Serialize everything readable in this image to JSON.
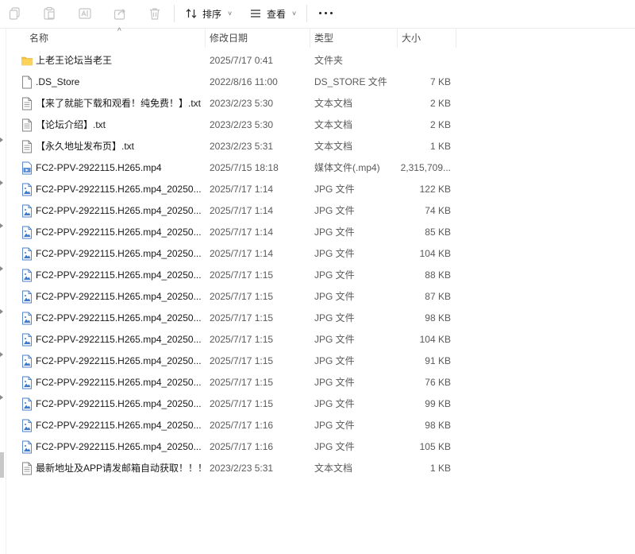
{
  "toolbar": {
    "sort_label": "排序",
    "view_label": "查看"
  },
  "columns": {
    "name": "名称",
    "modified": "修改日期",
    "type": "类型",
    "size": "大小"
  },
  "files": [
    {
      "icon": "folder-icon",
      "name": "上老王论坛当老王",
      "date": "2025/7/17 0:41",
      "type": "文件夹",
      "size": ""
    },
    {
      "icon": "file-icon",
      "name": ".DS_Store",
      "date": "2022/8/16 11:00",
      "type": "DS_STORE 文件",
      "size": "7 KB"
    },
    {
      "icon": "text-file-icon",
      "name": "【来了就能下载和观看！纯免费！】.txt",
      "date": "2023/2/23 5:30",
      "type": "文本文档",
      "size": "2 KB"
    },
    {
      "icon": "text-file-icon",
      "name": "【论坛介绍】.txt",
      "date": "2023/2/23 5:30",
      "type": "文本文档",
      "size": "2 KB"
    },
    {
      "icon": "text-file-icon",
      "name": "【永久地址发布页】.txt",
      "date": "2023/2/23 5:31",
      "type": "文本文档",
      "size": "1 KB"
    },
    {
      "icon": "video-file-icon",
      "name": "FC2-PPV-2922115.H265.mp4",
      "date": "2025/7/15 18:18",
      "type": "媒体文件(.mp4)",
      "size": "2,315,709..."
    },
    {
      "icon": "image-file-icon",
      "name": "FC2-PPV-2922115.H265.mp4_20250...",
      "date": "2025/7/17 1:14",
      "type": "JPG 文件",
      "size": "122 KB"
    },
    {
      "icon": "image-file-icon",
      "name": "FC2-PPV-2922115.H265.mp4_20250...",
      "date": "2025/7/17 1:14",
      "type": "JPG 文件",
      "size": "74 KB"
    },
    {
      "icon": "image-file-icon",
      "name": "FC2-PPV-2922115.H265.mp4_20250...",
      "date": "2025/7/17 1:14",
      "type": "JPG 文件",
      "size": "85 KB"
    },
    {
      "icon": "image-file-icon",
      "name": "FC2-PPV-2922115.H265.mp4_20250...",
      "date": "2025/7/17 1:14",
      "type": "JPG 文件",
      "size": "104 KB"
    },
    {
      "icon": "image-file-icon",
      "name": "FC2-PPV-2922115.H265.mp4_20250...",
      "date": "2025/7/17 1:15",
      "type": "JPG 文件",
      "size": "88 KB"
    },
    {
      "icon": "image-file-icon",
      "name": "FC2-PPV-2922115.H265.mp4_20250...",
      "date": "2025/7/17 1:15",
      "type": "JPG 文件",
      "size": "87 KB"
    },
    {
      "icon": "image-file-icon",
      "name": "FC2-PPV-2922115.H265.mp4_20250...",
      "date": "2025/7/17 1:15",
      "type": "JPG 文件",
      "size": "98 KB"
    },
    {
      "icon": "image-file-icon",
      "name": "FC2-PPV-2922115.H265.mp4_20250...",
      "date": "2025/7/17 1:15",
      "type": "JPG 文件",
      "size": "104 KB"
    },
    {
      "icon": "image-file-icon",
      "name": "FC2-PPV-2922115.H265.mp4_20250...",
      "date": "2025/7/17 1:15",
      "type": "JPG 文件",
      "size": "91 KB"
    },
    {
      "icon": "image-file-icon",
      "name": "FC2-PPV-2922115.H265.mp4_20250...",
      "date": "2025/7/17 1:15",
      "type": "JPG 文件",
      "size": "76 KB"
    },
    {
      "icon": "image-file-icon",
      "name": "FC2-PPV-2922115.H265.mp4_20250...",
      "date": "2025/7/17 1:15",
      "type": "JPG 文件",
      "size": "99 KB"
    },
    {
      "icon": "image-file-icon",
      "name": "FC2-PPV-2922115.H265.mp4_20250...",
      "date": "2025/7/17 1:16",
      "type": "JPG 文件",
      "size": "98 KB"
    },
    {
      "icon": "image-file-icon",
      "name": "FC2-PPV-2922115.H265.mp4_20250...",
      "date": "2025/7/17 1:16",
      "type": "JPG 文件",
      "size": "105 KB"
    },
    {
      "icon": "text-file-icon",
      "name": "最新地址及APP请发邮箱自动获取！！！...",
      "date": "2023/2/23 5:31",
      "type": "文本文档",
      "size": "1 KB"
    }
  ]
}
